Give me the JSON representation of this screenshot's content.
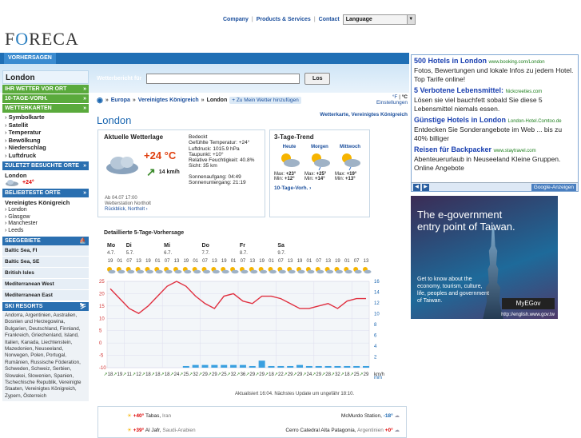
{
  "topnav": {
    "company": "Company",
    "products": "Products & Services",
    "contact": "Contact",
    "language": "Language"
  },
  "logo": "FORECA",
  "tab": "VORHERSAGEN",
  "sidebar": {
    "city": "London",
    "ihr_wetter": "IHR WETTER VOR ORT",
    "zehn_tage": "10-TAGE-VORH.",
    "wetterkarten": "WETTERKARTEN",
    "items": [
      "Symbolkarte",
      "Satellit",
      "Temperatur",
      "Bewölkung",
      "Niederschlag",
      "Luftdruck"
    ],
    "zuletzt": "ZULETZT BESUCHTE ORTE",
    "recent_city": "London",
    "recent_temp": "+24°",
    "beliebteste": "BELIEBTESTE ORTE",
    "country": "Vereinigtes Königreich",
    "places": [
      "London",
      "Glasgow",
      "Manchester",
      "Leeds"
    ],
    "seegebiete": "SEEGEBIETE",
    "seas": [
      "Baltic Sea, FI",
      "Baltic Sea, SE",
      "British Isles",
      "Mediterranean West",
      "Mediterranean East"
    ],
    "ski": "SKI RESORTS",
    "resorts": "Andorra, Argentinien, Australien, Bosnien und Herzegowina, Bulgarien, Deutschland, Finnland, Frankreich, Griechenland, Island, Italien, Kanada, Liechtenstein, Mazedonien, Neuseeland, Norwegen, Polen, Portugal, Rumänien, Russische Föderation, Schweden, Schweiz, Serbien, Slowakei, Slowenien, Spanien, Tschechische Republik, Vereinigte Staaten, Vereinigtes Königreich, Zypern, Österreich"
  },
  "search": {
    "label": "Wetterbericht für",
    "button": "Los"
  },
  "breadcrumb": {
    "europa": "Europa",
    "uk": "Vereinigtes Königreich",
    "city": "London",
    "fav": "+ Zu Mein Wetter hinzufügen"
  },
  "units": {
    "f": "°F",
    "c": "°C",
    "settings": "Einstellungen"
  },
  "title": "London",
  "maplink": "Wetterkarte, Vereinigtes Königreich",
  "current": {
    "heading": "Aktuelle Wetterlage",
    "temp": "+24 °C",
    "wind": "14 km/h",
    "lines": [
      "Bedeckt",
      "Gefühlte Temperatur: +24°",
      "Luftdruck: 1015.9 hPa",
      "Taupunkt: +10°",
      "Relative Feuchtigkeit: 40.8%",
      "Sicht: 35 km",
      "",
      "Sonnenaufgang: 04:49",
      "Sonnenuntergang: 21:19"
    ],
    "obs": "Ab 04.07 17:00",
    "station": "Wetterstation Northolt",
    "back": "Rückblick, Northolt ›"
  },
  "trend": {
    "heading": "3-Tage-Trend",
    "days": [
      {
        "name": "Heute",
        "max": "+23°",
        "min": "+12°"
      },
      {
        "name": "Morgen",
        "max": "+25°",
        "min": "+14°"
      },
      {
        "name": "Mittwoch",
        "max": "+19°",
        "min": "+13°"
      }
    ],
    "link": "10-Tage-Vorh. ›"
  },
  "forecast": {
    "heading": "Detaillierte 5-Tage-Vorhersage",
    "days": [
      "Mo",
      "Di",
      "Mi",
      "Do",
      "Fr",
      "Sa"
    ],
    "dates": [
      "4.7.",
      "5.7.",
      "6.7.",
      "7.7.",
      "8.7.",
      "9.7."
    ],
    "hours": [
      "19",
      "01",
      "07",
      "13",
      "19",
      "01",
      "07",
      "13",
      "19",
      "01",
      "07",
      "13",
      "19",
      "01",
      "07",
      "13",
      "19",
      "01",
      "07",
      "13",
      "19",
      "01",
      "07",
      "13",
      "19",
      "01",
      "07",
      "13"
    ],
    "left_axis": [
      "25",
      "20",
      "15",
      "10",
      "5",
      "0",
      "-5",
      "-10"
    ],
    "right_axis": [
      "16",
      "14",
      "12",
      "10",
      "8",
      "6",
      "4",
      "2",
      "mm"
    ],
    "winds": [
      "18",
      "19",
      "11",
      "12",
      "18",
      "18",
      "18",
      "24",
      "25",
      "32",
      "29",
      "29",
      "25",
      "32",
      "36",
      "29",
      "29",
      "18",
      "22",
      "29",
      "29",
      "24",
      "29",
      "28",
      "32",
      "18",
      "25",
      "29"
    ],
    "wind_unit": "km/h",
    "updated": "Aktualisiert 16:04. Nächstes Update um ungefähr 18:10."
  },
  "chart_data": {
    "type": "line",
    "title": "Detaillierte 5-Tage-Vorhersage",
    "x": [
      "19",
      "01",
      "07",
      "13",
      "19",
      "01",
      "07",
      "13",
      "19",
      "01",
      "07",
      "13",
      "19",
      "01",
      "07",
      "13",
      "19",
      "01",
      "07",
      "13",
      "19",
      "01",
      "07",
      "13",
      "19",
      "01",
      "07",
      "13"
    ],
    "series": [
      {
        "values": [
          22,
          18,
          14,
          12,
          15,
          19,
          23,
          25,
          23,
          19,
          16,
          14,
          19,
          20,
          17,
          16,
          19,
          19,
          18,
          16,
          14,
          14,
          15,
          16,
          14,
          17,
          18,
          18
        ]
      }
    ],
    "bars": [
      0,
      0,
      0,
      0,
      0,
      0,
      0,
      0,
      0.3,
      0.5,
      0.5,
      0.5,
      0.5,
      0.5,
      0.5,
      0.3,
      1.3,
      0.3,
      0.3,
      0.3,
      0.5,
      0.3,
      0.3,
      0.3,
      0.3,
      0.3,
      0.3,
      0.3
    ],
    "ylim": [
      -10,
      25
    ],
    "ylim_right": [
      0,
      16
    ]
  },
  "extremes": [
    {
      "temp": "+40°",
      "place": "Tabas",
      "country": "Iran"
    },
    {
      "temp": "+39°",
      "place": "Al Jafr",
      "country": "Saudi-Arabien"
    }
  ],
  "extremes_right": [
    {
      "place": "McMurdo Station",
      "temp": "-18°"
    },
    {
      "place": "Cerro Catedral Alta Patagonia",
      "country": "Argentinien",
      "temp": "+0°"
    }
  ],
  "ad": {
    "items": [
      {
        "h": "500 Hotels in London",
        "u": "www.booking.com/London",
        "t": "Fotos, Bewertungen und lokale Infos zu jedem Hotel. Top Tarife online!"
      },
      {
        "h": "5 Verbotene Lebensmittel:",
        "u": "Nickcreeties.com",
        "t": "Lösen sie viel bauchfett sobald Sie diese 5 Lebensmittel niemals essen."
      },
      {
        "h": "Günstige Hotels in London",
        "u": "London-Hotel.Comtoo.de",
        "t": "Entdecken Sie Sonderangebote im Web ... bis zu 40% billiger"
      },
      {
        "h": "Reisen für Backpacker",
        "u": "www.staytravel.com",
        "t": "Abenteuerurlaub in Neuseeland Kleine Gruppen. Online Angebote"
      }
    ],
    "google": "Google-Anzeigen"
  },
  "banner": {
    "line1": "The e-government",
    "line2": "entry point of Taiwan.",
    "text": "Get to know about the economy, tourism, culture, life, peoples and government of Taiwan.",
    "brand": "MyEGov",
    "url": "http://english.www.gov.tw"
  }
}
